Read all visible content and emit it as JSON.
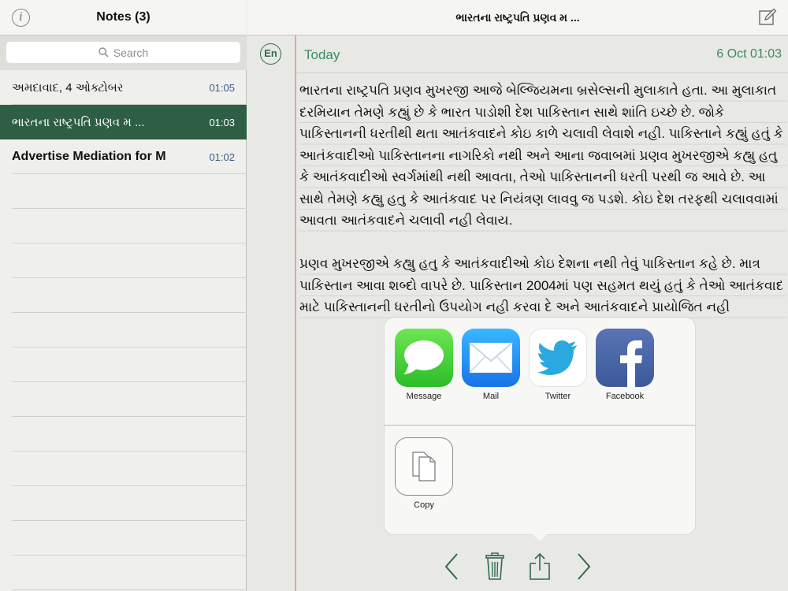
{
  "sidebar": {
    "title": "Notes (3)",
    "info_icon": "info-icon",
    "search_placeholder": "Search",
    "notes": [
      {
        "title": "અમદાવાદ, 4 ઓક્ટોબર",
        "time": "01:05"
      },
      {
        "title": "ભારતના રાષ્ટ્રપતિ પ્રણવ મ ...",
        "time": "01:03"
      },
      {
        "title": "Advertise Mediation for M",
        "time": "01:02"
      }
    ]
  },
  "main": {
    "title": "ભારતના રાષ્ટ્રપતિ પ્રણવ મ ...",
    "language_button": "En",
    "date_label": "Today",
    "date_time": "6 Oct 01:03",
    "paragraphs": [
      "ભારતના રાષ્ટ્રપતિ પ્રણવ મુખરજી આજે બેલ્જિયમના બ્રસેલ્સની મુલાકાતે હતા. આ મુલાકાત દરમિયાન તેમણે કહ્યું છે કે ભારત પાડોશી દેશ પાકિસ્તાન સાથે શાંતિ ઇચ્છે છે. જોકે પાકિસ્તાનની ધરતીથી થતા આતંકવાદને કોઇ કાળે ચલાવી લેવાશે નહી. પાકિસ્તાને કહ્યું હતું કે આતંકવાદીઓ પાકિસ્તાનના નાગરિકો નથી અને આના જવાબમાં પ્રણવ મુખરજીએ કહ્યુ હતુ કે આતંકવાદીઓ સ્વર્ગમાંથી નથી આવતા, તેઓ પાકિસ્તાનની ધરતી પરથી જ આવે છે. આ સાથે તેમણે કહ્યુ હતુ કે આતંકવાદ પર નિયંત્રણ લાવવુ જ પડશે. કોઇ દેશ તરફથી ચલાવવામાં આવતા આતંકવાદને ચલાવી નહી લેવાય.",
      "પ્રણવ મુખરજીએ કહ્યુ હતુ કે આતંકવાદીઓ કોઇ દેશના નથી તેવું પાકિસ્તાન કહે છે. માત્ર પાકિસ્તાન આવા શબ્દો વાપરે છે. પાકિસ્તાન 2004માં પણ સહમત થયું હતું કે તેઓ આતંકવાદ માટે પાકિસ્તાનની ધરતીનો ઉપયોગ નહી કરવા દે અને આતંકવાદને પ્રાયોજિત નહી"
    ]
  },
  "share_sheet": {
    "apps": [
      {
        "label": "Message",
        "icon": "message-icon",
        "color": "#2bbd29"
      },
      {
        "label": "Mail",
        "icon": "mail-icon",
        "color": "#1873e9"
      },
      {
        "label": "Twitter",
        "icon": "twitter-icon",
        "color": "#1da1f2"
      },
      {
        "label": "Facebook",
        "icon": "facebook-icon",
        "color": "#3b5998"
      }
    ],
    "actions": [
      {
        "label": "Copy",
        "icon": "copy-icon"
      }
    ]
  },
  "toolbar": {
    "icons": [
      "chevron-left-icon",
      "trash-icon",
      "share-icon",
      "chevron-right-icon"
    ],
    "accent_color": "#2e6a4b"
  },
  "colors": {
    "accent_green": "#2e5f45",
    "date_green": "#3e8a62",
    "time_blue": "#3b5e8c",
    "margin_red": "#e0a7a7"
  }
}
